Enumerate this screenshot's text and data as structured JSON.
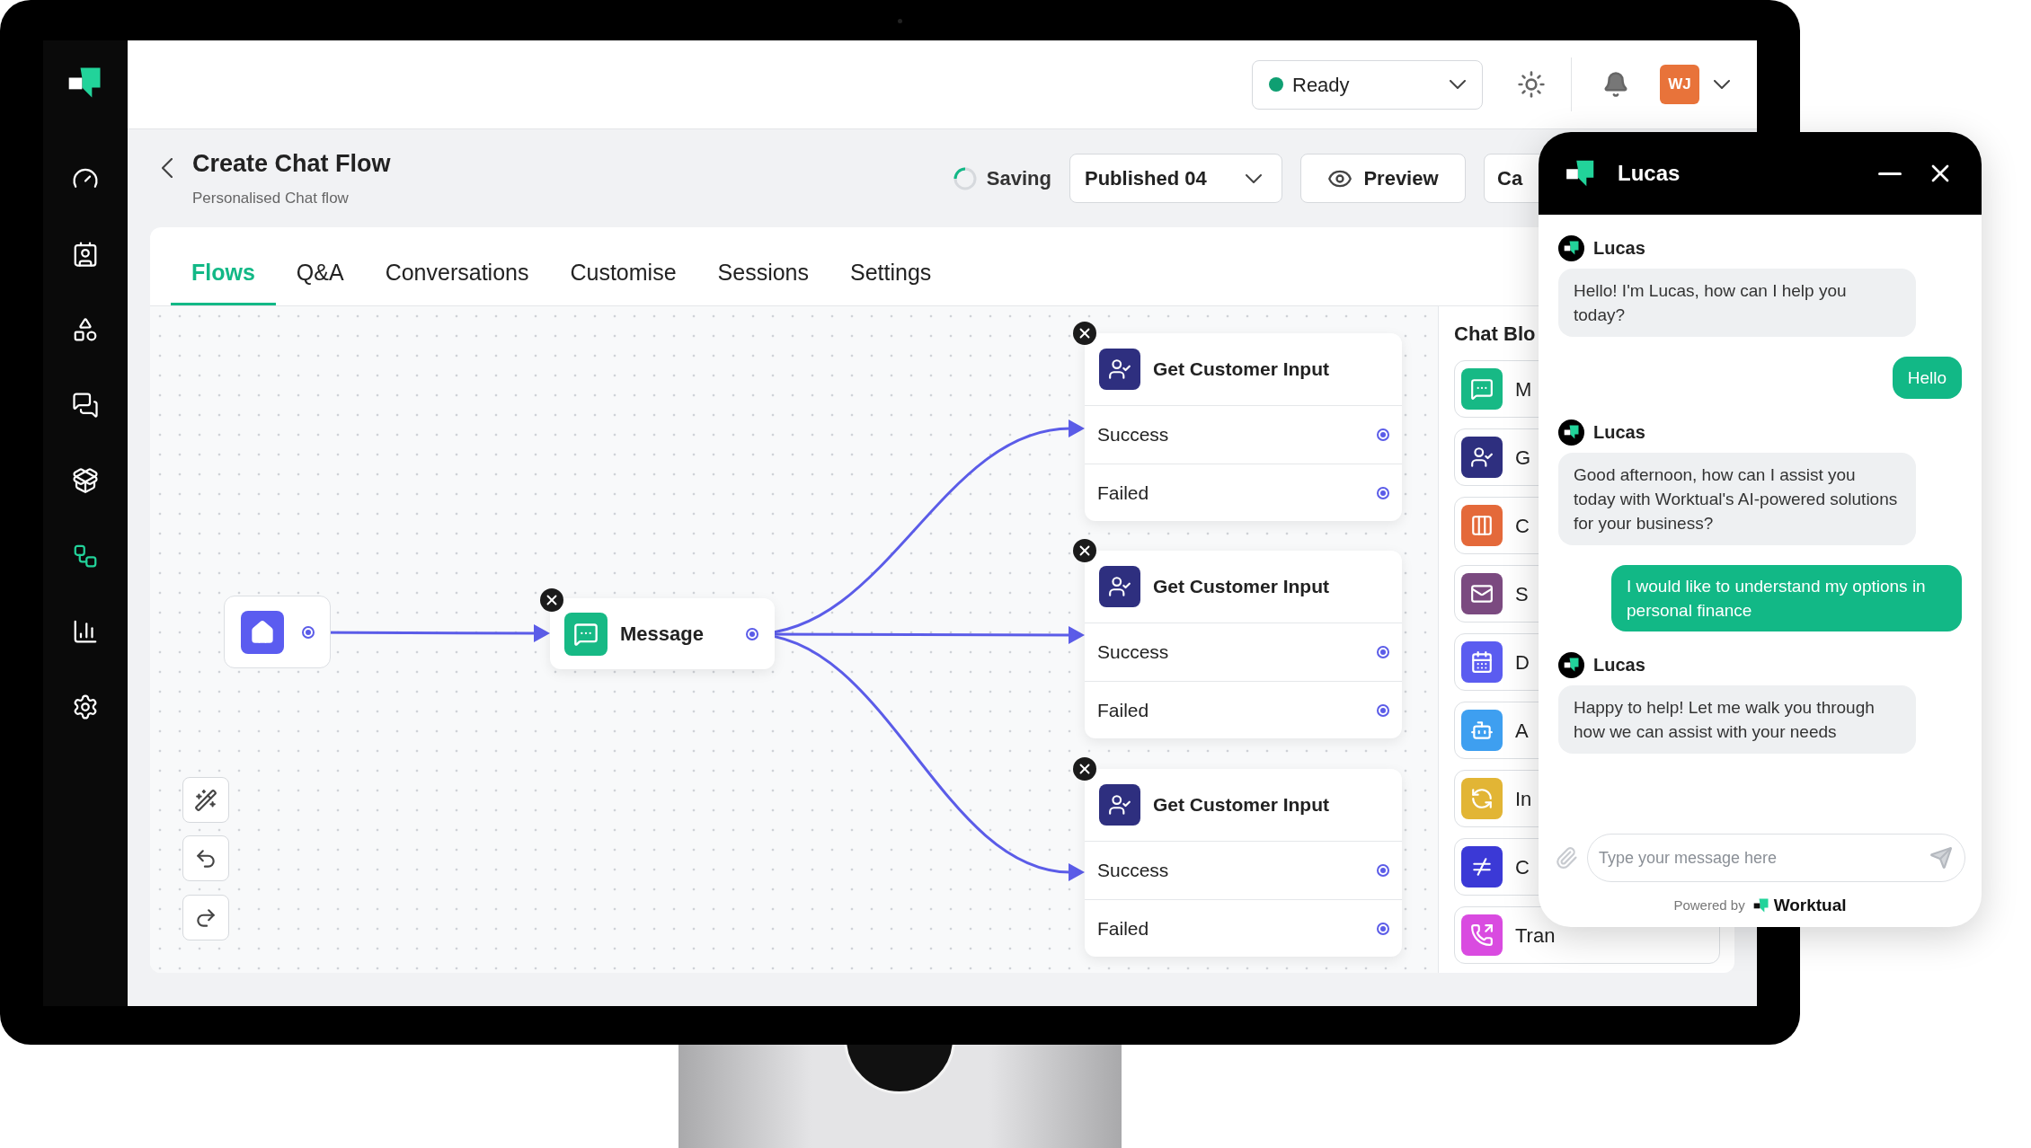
{
  "sidebar": {
    "items": [
      {
        "selected": false
      },
      {
        "selected": false
      },
      {
        "selected": false
      },
      {
        "selected": false
      },
      {
        "selected": false
      },
      {
        "selected": true
      },
      {
        "selected": false
      },
      {
        "selected": false
      }
    ]
  },
  "top_bar": {
    "status": "Ready",
    "avatar": "WJ"
  },
  "header": {
    "title": "Create Chat Flow",
    "subtitle": "Personalised Chat flow",
    "saving": "Saving",
    "version": "Published 04",
    "preview": "Preview",
    "button_4": "Ca"
  },
  "tabs": [
    {
      "label": "Flows",
      "selected": true
    },
    {
      "label": "Q&A",
      "selected": false
    },
    {
      "label": "Conversations",
      "selected": false
    },
    {
      "label": "Customise",
      "selected": false
    },
    {
      "label": "Sessions",
      "selected": false
    },
    {
      "label": "Settings",
      "selected": false
    }
  ],
  "canvas": {
    "message_node": {
      "title": "Message"
    },
    "input_nodes": [
      {
        "title": "Get Customer Input",
        "outputs": [
          "Success",
          "Failed"
        ]
      },
      {
        "title": "Get Customer Input",
        "outputs": [
          "Success",
          "Failed"
        ]
      },
      {
        "title": "Get Customer Input",
        "outputs": [
          "Success",
          "Failed"
        ]
      }
    ]
  },
  "chat_blocks": {
    "title": "Chat Blo",
    "items": [
      {
        "label": "M",
        "color": "#17b985"
      },
      {
        "label": "G",
        "color": "#2e2f7f"
      },
      {
        "label": "C",
        "color": "#e4693a"
      },
      {
        "label": "S",
        "color": "#7b4a80"
      },
      {
        "label": "D",
        "color": "#5b5cf0"
      },
      {
        "label": "A",
        "color": "#3e9ff0"
      },
      {
        "label": "In",
        "color": "#e2b535"
      },
      {
        "label": "C",
        "color": "#3b39d6"
      },
      {
        "label": "Tran",
        "color": "#d94be0"
      }
    ]
  },
  "chat_widget": {
    "title": "Lucas",
    "messages": [
      {
        "kind": "bot",
        "name": "Lucas",
        "text": "Hello! I'm Lucas, how can I help you today?"
      },
      {
        "kind": "user",
        "text": "Hello"
      },
      {
        "kind": "bot",
        "name": "Lucas",
        "text": "Good afternoon, how can I assist you today with Worktual's AI-powered solutions for your business?"
      },
      {
        "kind": "user",
        "text": "I would like to understand my options in personal finance"
      },
      {
        "kind": "bot",
        "name": "Lucas",
        "text": "Happy to help! Let me walk you through how we can assist with your needs"
      }
    ],
    "input": {
      "placeholder": "Type your message here"
    },
    "powered_by": "Powered by",
    "brand": "Worktual"
  }
}
